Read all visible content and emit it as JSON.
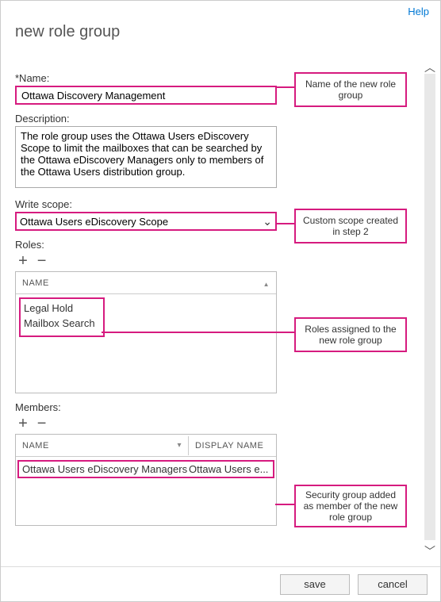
{
  "help_label": "Help",
  "page_title": "new role group",
  "name_label": "*Name:",
  "name_value": "Ottawa Discovery Management",
  "desc_label": "Description:",
  "desc_value": "The role group uses the Ottawa Users eDiscovery Scope to limit the mailboxes that can be searched by the Ottawa eDiscovery Managers only to members of the Ottawa Users distribution group.",
  "scope_label": "Write scope:",
  "scope_value": "Ottawa Users eDiscovery Scope",
  "roles_label": "Roles:",
  "members_label": "Members:",
  "col_name": "NAME",
  "col_display": "DISPLAY NAME",
  "roles": {
    "items": [
      {
        "name": "Legal Hold"
      },
      {
        "name": "Mailbox Search"
      }
    ]
  },
  "members": {
    "items": [
      {
        "name": "Ottawa Users eDiscovery Managers",
        "display": "Ottawa Users e..."
      }
    ]
  },
  "annotations": {
    "name": "Name of the new role group",
    "scope": "Custom scope created in step 2",
    "roles": "Roles assigned to the new role group",
    "members": "Security group added as member of the new role group"
  },
  "buttons": {
    "save": "save",
    "cancel": "cancel"
  },
  "icons": {
    "plus": "+",
    "minus": "−",
    "chevron_up": "︿",
    "chevron_down": "﹀"
  }
}
